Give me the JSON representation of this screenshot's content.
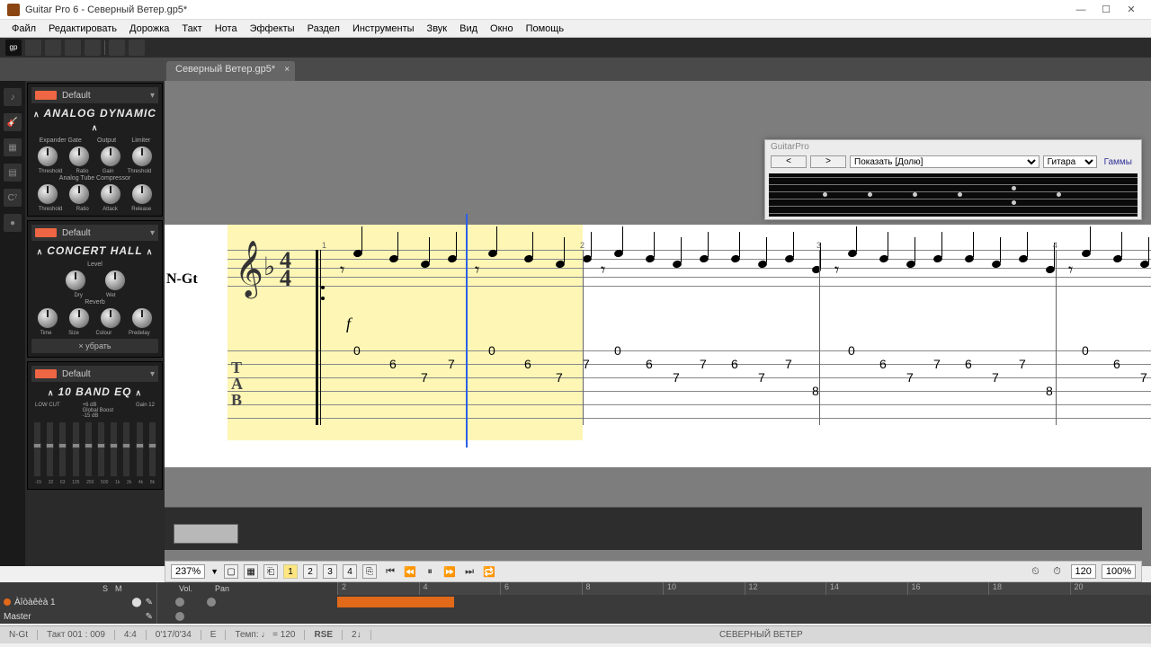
{
  "window": {
    "title": "Guitar Pro 6 - Северный Ветер.gp5*"
  },
  "menu": [
    "Файл",
    "Редактировать",
    "Дорожка",
    "Такт",
    "Нота",
    "Эффекты",
    "Раздел",
    "Инструменты",
    "Звук",
    "Вид",
    "Окно",
    "Помощь"
  ],
  "tab": {
    "name": "Северный Ветер.gp5*"
  },
  "fx": {
    "mod1": {
      "preset": "Default",
      "title": "ANALOG DYNAMIC",
      "sub_sections": [
        "Expander Gate",
        "Output",
        "Limiter"
      ],
      "knob_labels1": [
        "Threshold",
        "Ratio",
        "Gain",
        "Threshold"
      ],
      "section2": "Analog Tube Compressor",
      "knob_labels2": [
        "Threshold",
        "Ratio",
        "Attack",
        "Release"
      ]
    },
    "mod2": {
      "preset": "Default",
      "title": "CONCERT HALL",
      "section1": "Level",
      "knob_labels1": [
        "Dry",
        "Wet"
      ],
      "section2": "Reverb",
      "knob_labels2": [
        "Time",
        "Size",
        "Colour",
        "Predelay"
      ],
      "remove": "× убрать"
    },
    "mod3": {
      "preset": "Default",
      "title": "10 BAND EQ",
      "labels": [
        "LOW CUT",
        "Global Boost",
        "Gain 12"
      ],
      "db_top": "+6 dB",
      "db_bot": "-15 dB",
      "freqs": [
        "-15",
        "32",
        "63",
        "125",
        "250",
        "500",
        "1k",
        "2k",
        "4k",
        "8k"
      ]
    }
  },
  "fretboard": {
    "title": "GuitarPro",
    "prev": "<",
    "next": ">",
    "dropdown1": "Показать [Долю]",
    "dropdown2": "Гитара",
    "link": "Гаммы"
  },
  "score": {
    "track": "N-Gt",
    "time_sig_top": "4",
    "time_sig_bot": "4",
    "dynamic": "f",
    "tab_pattern": [
      {
        "str": 2,
        "fret": "0"
      },
      {
        "str": 3,
        "fret": "6"
      },
      {
        "str": 4,
        "fret": "7"
      },
      {
        "str": 3,
        "fret": "7"
      },
      {
        "str": 3,
        "fret": "6"
      },
      {
        "str": 4,
        "fret": "7"
      },
      {
        "str": 3,
        "fret": "7"
      },
      {
        "str": 5,
        "fret": "8"
      }
    ],
    "bars": [
      "1",
      "2",
      "3",
      "4"
    ]
  },
  "controls": {
    "zoom": "237%",
    "pages": [
      "1",
      "2",
      "3",
      "4"
    ],
    "current_page": "1",
    "spin_val": "120",
    "zoom_pct": "100%"
  },
  "mixer": {
    "hdr": [
      "S",
      "M"
    ],
    "cols": [
      "Vol.",
      "Pan"
    ],
    "tracks": [
      {
        "name": "Àîòàêèà 1",
        "color": "#e0691a"
      },
      {
        "name": "Master",
        "color": "#fff"
      }
    ],
    "ruler": [
      "2",
      "4",
      "6",
      "8",
      "10",
      "12",
      "14",
      "16",
      "18",
      "20"
    ]
  },
  "status": {
    "track": "N-Gt",
    "pos": "Такт 001 : 009",
    "sig": "4:4",
    "time": "0'17/0'34",
    "key": "E",
    "tempo": "Темп: ♩ = 120",
    "rse": "RSE",
    "ch": "2↓",
    "title": "СЕВЕРНЫЙ ВЕТЕР"
  }
}
